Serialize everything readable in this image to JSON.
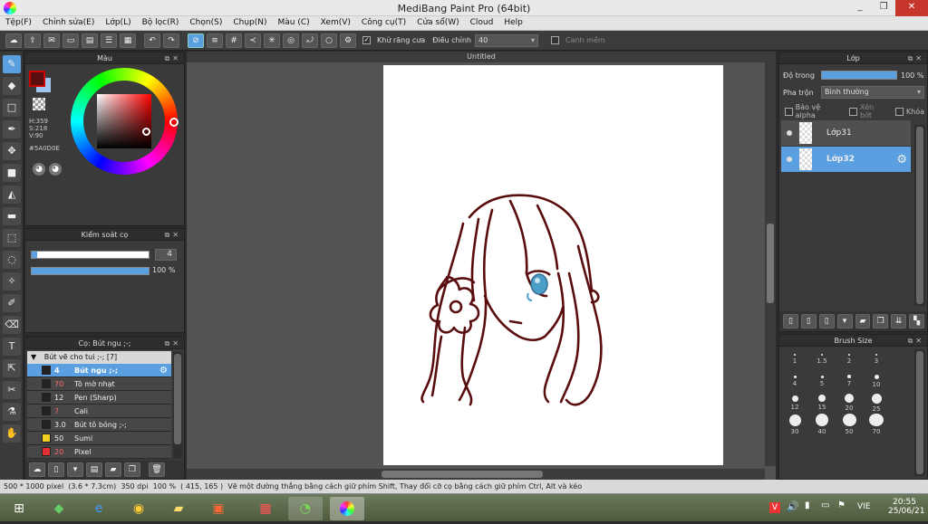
{
  "window": {
    "title": "MediBang Paint Pro (64bit)",
    "minimize": "_",
    "maximize": "❐",
    "close": "✕"
  },
  "menu": [
    "Tệp(F)",
    "Chỉnh sửa(E)",
    "Lớp(L)",
    "Bộ lọc(R)",
    "Chọn(S)",
    "Chụp(N)",
    "Màu (C)",
    "Xem(V)",
    "Công cụ(T)",
    "Cửa sổ(W)",
    "Cloud",
    "Help"
  ],
  "toolbar": {
    "antialias_label": "Khử răng cưa",
    "adjust_label": "Điều chỉnh",
    "adjust_value": "40",
    "snap_label": "Canh mềm"
  },
  "color_panel": {
    "title": "Màu",
    "h": "H:359",
    "s": "S:218",
    "v": "V:90",
    "hex": "#5A0D0E",
    "primary": "#5a0d0e",
    "secondary": "#9fc5ef"
  },
  "brush_control": {
    "title": "Kiểm soát cọ",
    "size": "4",
    "opacity": "100 %"
  },
  "brush_panel": {
    "title": "Cọ: Bút ngu ;-;",
    "group": "Bút vẽ cho tui ;-; [7]",
    "items": [
      {
        "size": "4",
        "name": "Bút ngu ;-;",
        "color": "#222222",
        "selected": true
      },
      {
        "size": "70",
        "name": "Tô mờ nhạt",
        "color": "#222222",
        "selected": false
      },
      {
        "size": "12",
        "name": "Pen (Sharp)",
        "color": "#222222",
        "selected": false
      },
      {
        "size": "7",
        "name": "Cali",
        "color": "#222222",
        "selected": false
      },
      {
        "size": "3.0",
        "name": "Bút tô bóng ;-;",
        "color": "#222222",
        "selected": false
      },
      {
        "size": "50",
        "name": "Sumi",
        "color": "#f0d020",
        "selected": false
      },
      {
        "size": "20",
        "name": "Pixel",
        "color": "#e03030",
        "selected": false
      }
    ]
  },
  "canvas": {
    "tab": "Untitled",
    "line_color": "#5a0d0e",
    "eye_color": "#4a9ec8"
  },
  "layer_panel": {
    "title": "Lớp",
    "opacity_label": "Độ trong",
    "opacity_value": "100 %",
    "blend_label": "Pha trộn",
    "blend_value": "Bình thường",
    "protect_alpha": "Bảo vệ alpha",
    "clipping": "Xén bớt",
    "lock": "Khóa",
    "layers": [
      {
        "name": "Lớp31",
        "selected": false
      },
      {
        "name": "Lớp32",
        "selected": true
      }
    ]
  },
  "brush_size_panel": {
    "title": "Brush Size",
    "sizes": [
      "1",
      "1.5",
      "2",
      "3",
      "4",
      "5",
      "7",
      "10",
      "12",
      "15",
      "20",
      "25",
      "30",
      "40",
      "50",
      "70"
    ]
  },
  "statusbar": {
    "dims": "500 * 1000 pixel",
    "phys": "(3.6 * 7.3cm)",
    "dpi": "350 dpi",
    "zoom": "100 %",
    "coords": "( 415, 165 )",
    "hint": "Vẽ một đường thẳng bằng cách giữ phím Shift, Thay đổi cỡ cọ bằng cách giữ phím Ctrl, Alt và kéo"
  },
  "taskbar": {
    "lang": "VIE",
    "time": "20:55",
    "date": "25/06/21"
  }
}
